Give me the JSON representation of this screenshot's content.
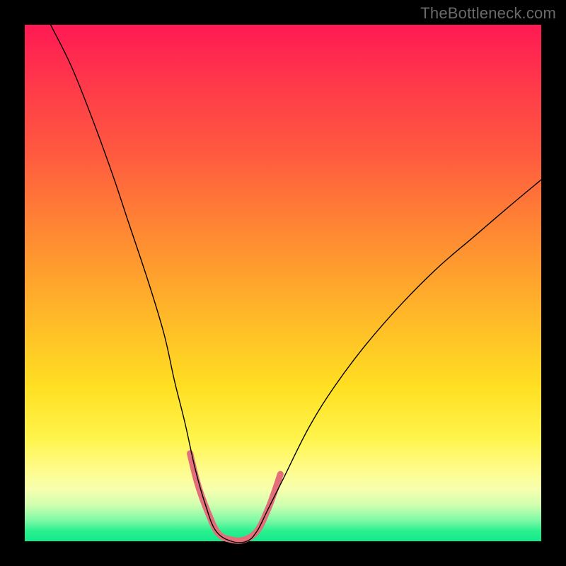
{
  "watermark": "TheBottleneck.com",
  "chart_data": {
    "type": "line",
    "title": "",
    "xlabel": "",
    "ylabel": "",
    "xlim": [
      0,
      100
    ],
    "ylim": [
      0,
      100
    ],
    "grid": false,
    "series": [
      {
        "name": "black-curve",
        "color": "#000000",
        "width": 1.4,
        "points": [
          {
            "x": 5,
            "y": 100
          },
          {
            "x": 9,
            "y": 92
          },
          {
            "x": 13,
            "y": 82
          },
          {
            "x": 17,
            "y": 71
          },
          {
            "x": 20,
            "y": 62
          },
          {
            "x": 24,
            "y": 50
          },
          {
            "x": 27,
            "y": 40
          },
          {
            "x": 29,
            "y": 31
          },
          {
            "x": 31,
            "y": 23
          },
          {
            "x": 33,
            "y": 14
          },
          {
            "x": 35,
            "y": 7
          },
          {
            "x": 37,
            "y": 2
          },
          {
            "x": 40,
            "y": 0
          },
          {
            "x": 43,
            "y": 0
          },
          {
            "x": 45,
            "y": 2
          },
          {
            "x": 47,
            "y": 6
          },
          {
            "x": 50,
            "y": 12
          },
          {
            "x": 55,
            "y": 22
          },
          {
            "x": 60,
            "y": 30
          },
          {
            "x": 66,
            "y": 38
          },
          {
            "x": 73,
            "y": 46
          },
          {
            "x": 80,
            "y": 53
          },
          {
            "x": 87,
            "y": 59
          },
          {
            "x": 94,
            "y": 65
          },
          {
            "x": 100,
            "y": 70
          }
        ]
      },
      {
        "name": "pink-highlight",
        "color": "#e26f7a",
        "width": 9,
        "points": [
          {
            "x": 32.0,
            "y": 17.0
          },
          {
            "x": 33.5,
            "y": 11.0
          },
          {
            "x": 35.5,
            "y": 5.5
          },
          {
            "x": 37.5,
            "y": 1.5
          },
          {
            "x": 40.0,
            "y": 0.3
          },
          {
            "x": 42.5,
            "y": 0.3
          },
          {
            "x": 45.0,
            "y": 2.0
          },
          {
            "x": 47.0,
            "y": 6.0
          },
          {
            "x": 48.5,
            "y": 10.0
          },
          {
            "x": 49.5,
            "y": 13.0
          }
        ]
      }
    ]
  }
}
